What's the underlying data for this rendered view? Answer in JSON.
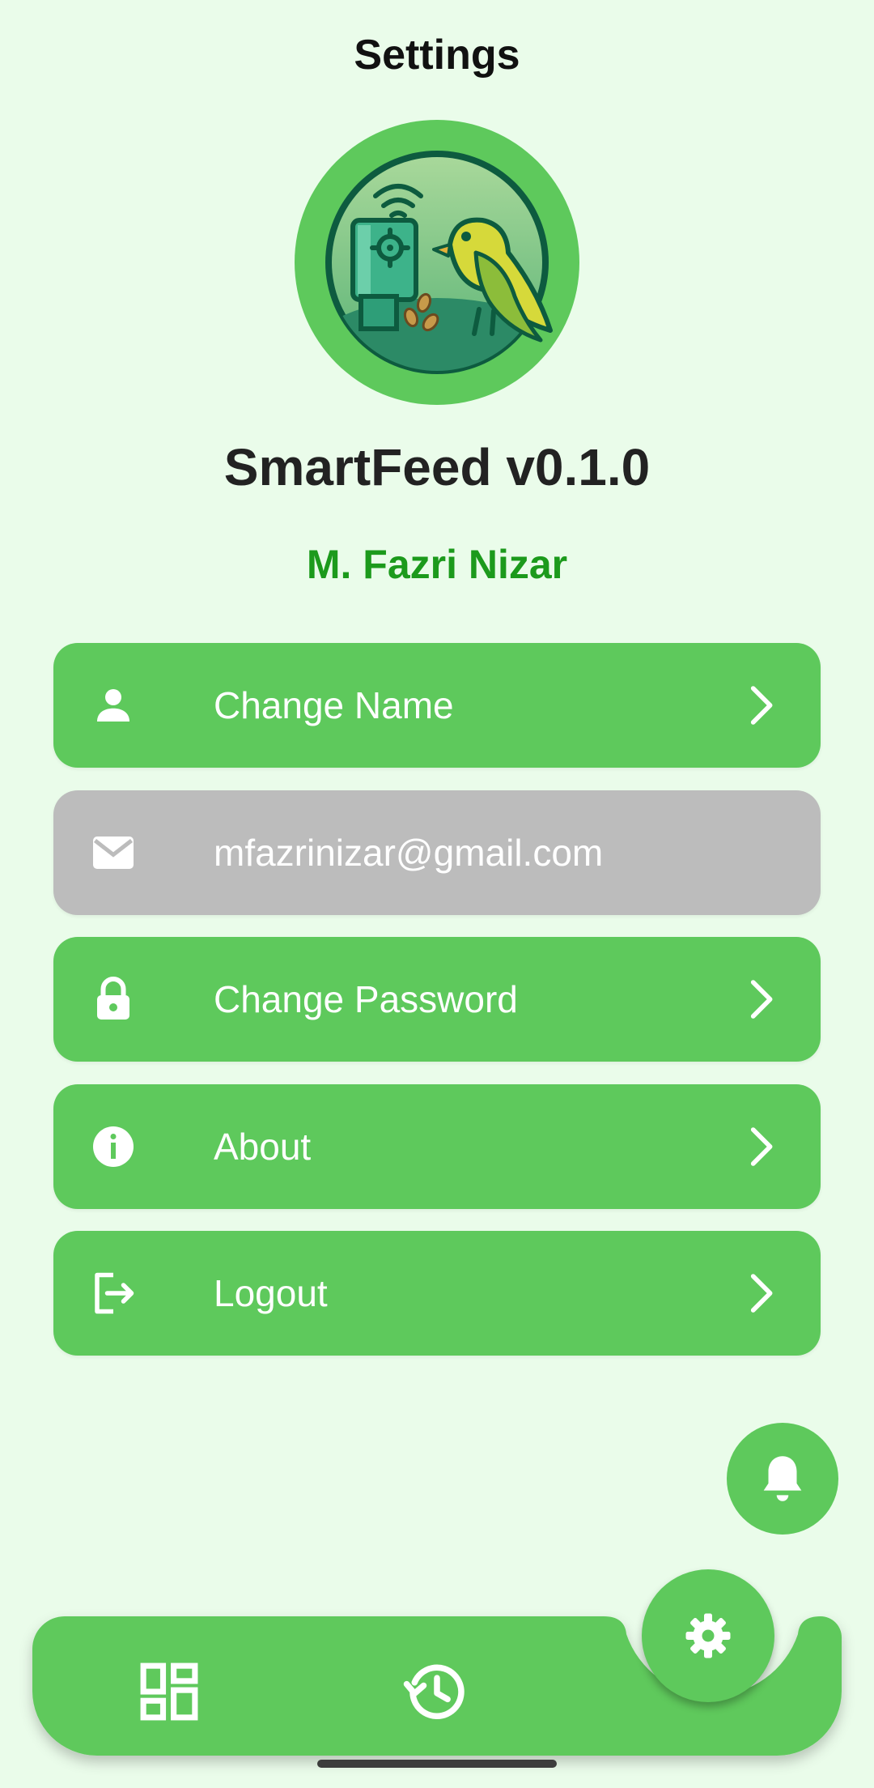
{
  "header": {
    "title": "Settings"
  },
  "app": {
    "version_label": "SmartFeed v0.1.0",
    "logo_icon": "bird-feeder-logo"
  },
  "user": {
    "name": "M. Fazri Nizar"
  },
  "menu": {
    "items": [
      {
        "label": "Change Name",
        "icon": "person-icon",
        "enabled": true
      },
      {
        "label": "mfazrinizar@gmail.com",
        "icon": "mail-icon",
        "enabled": false
      },
      {
        "label": "Change Password",
        "icon": "lock-icon",
        "enabled": true
      },
      {
        "label": "About",
        "icon": "info-icon",
        "enabled": true
      },
      {
        "label": "Logout",
        "icon": "logout-icon",
        "enabled": true
      }
    ]
  },
  "fab": {
    "icon": "bell-icon"
  },
  "bottom_nav": {
    "items": [
      {
        "icon": "dashboard-icon",
        "active": false
      },
      {
        "icon": "history-icon",
        "active": false
      },
      {
        "icon": "gear-icon",
        "active": true
      }
    ]
  },
  "colors": {
    "background": "#eafcea",
    "accent": "#5ec95c",
    "accent_text": "#1c9a1c",
    "disabled": "#bcbcbc"
  }
}
